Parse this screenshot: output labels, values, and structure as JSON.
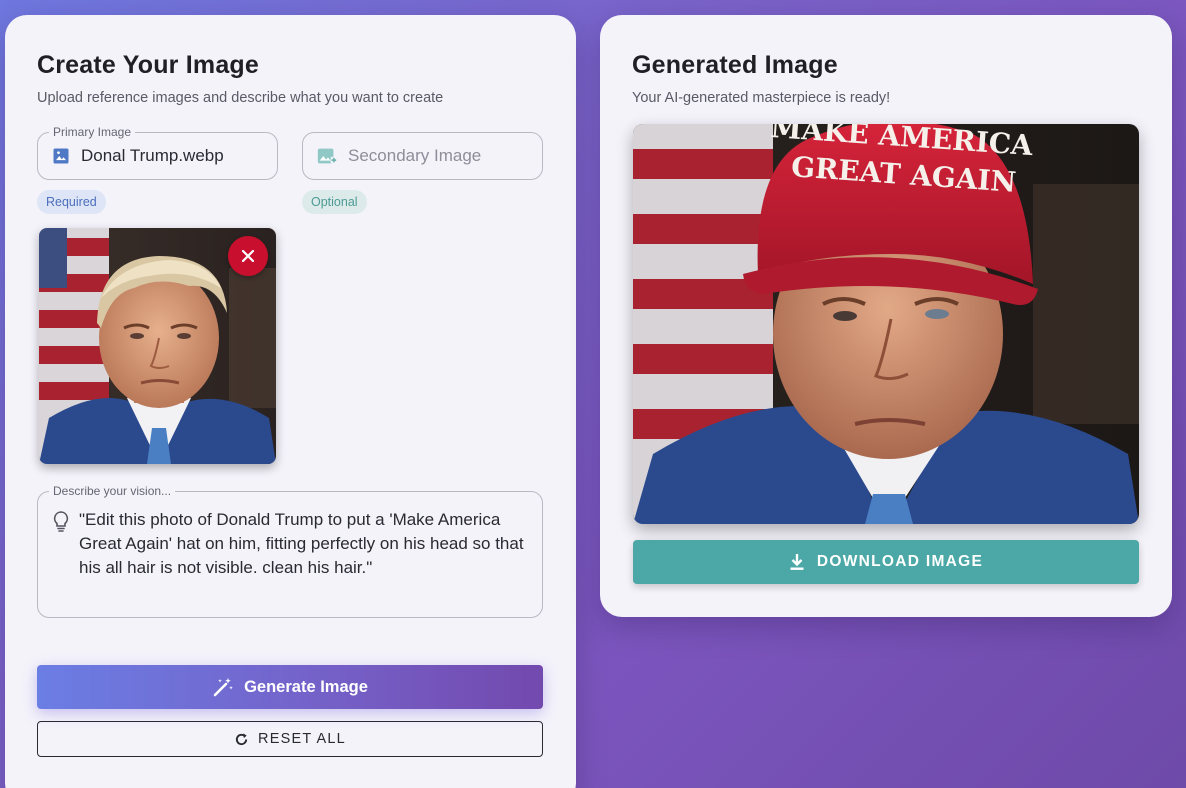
{
  "left_card": {
    "title": "Create Your Image",
    "subtitle": "Upload reference images and describe what you want to create",
    "primary": {
      "legend": "Primary Image",
      "value": "Donal Trump.webp",
      "chip": "Required"
    },
    "secondary": {
      "placeholder": "Secondary Image",
      "chip": "Optional"
    },
    "vision": {
      "legend": "Describe your vision...",
      "text": "\"Edit this photo of Donald Trump to put a 'Make America Great Again' hat on him, fitting perfectly on his head so that his all hair is not visible. clean his hair.\""
    },
    "generate_label": "Generate Image",
    "reset_label": "RESET ALL"
  },
  "right_card": {
    "title": "Generated Image",
    "subtitle": "Your AI-generated masterpiece is ready!",
    "hat_line1": "MAKE AMERICA",
    "hat_line2": "GREAT AGAIN",
    "download_label": "DOWNLOAD IMAGE"
  },
  "colors": {
    "accent_gradient_start": "#6b7ee4",
    "accent_gradient_end": "#7349ae",
    "download": "#4ba8a6",
    "remove": "#c8102e",
    "required_chip": "#4d6fbd",
    "optional_chip": "#4d9a95"
  },
  "icons": {
    "primary_field": "image-icon",
    "secondary_field": "add-photo-icon",
    "remove": "close-icon",
    "vision": "lightbulb-icon",
    "generate": "magic-wand-icon",
    "reset": "refresh-icon",
    "download": "download-icon"
  }
}
